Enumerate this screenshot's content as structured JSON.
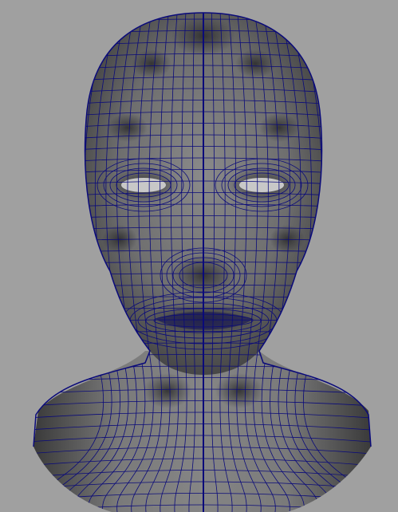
{
  "viewport": {
    "mode": "wireframe-on-shaded",
    "background_color": "#a0a0a0",
    "wire_color": "#0a0a7a",
    "shade_light": "#8a8a8a",
    "shade_dark": "#3c3c3c",
    "object": "head"
  }
}
